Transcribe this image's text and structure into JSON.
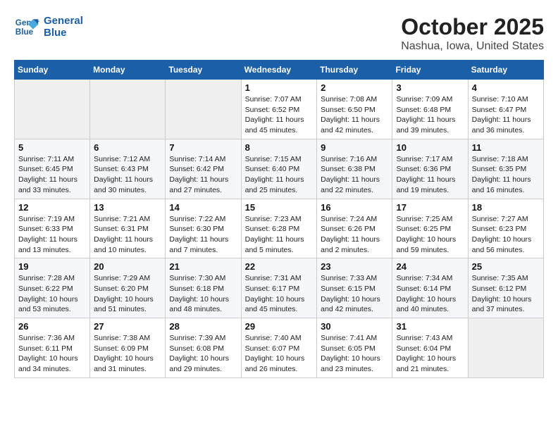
{
  "header": {
    "logo_line1": "General",
    "logo_line2": "Blue",
    "title": "October 2025",
    "subtitle": "Nashua, Iowa, United States"
  },
  "days_of_week": [
    "Sunday",
    "Monday",
    "Tuesday",
    "Wednesday",
    "Thursday",
    "Friday",
    "Saturday"
  ],
  "weeks": [
    [
      {
        "day": "",
        "info": ""
      },
      {
        "day": "",
        "info": ""
      },
      {
        "day": "",
        "info": ""
      },
      {
        "day": "1",
        "info": "Sunrise: 7:07 AM\nSunset: 6:52 PM\nDaylight: 11 hours and 45 minutes."
      },
      {
        "day": "2",
        "info": "Sunrise: 7:08 AM\nSunset: 6:50 PM\nDaylight: 11 hours and 42 minutes."
      },
      {
        "day": "3",
        "info": "Sunrise: 7:09 AM\nSunset: 6:48 PM\nDaylight: 11 hours and 39 minutes."
      },
      {
        "day": "4",
        "info": "Sunrise: 7:10 AM\nSunset: 6:47 PM\nDaylight: 11 hours and 36 minutes."
      }
    ],
    [
      {
        "day": "5",
        "info": "Sunrise: 7:11 AM\nSunset: 6:45 PM\nDaylight: 11 hours and 33 minutes."
      },
      {
        "day": "6",
        "info": "Sunrise: 7:12 AM\nSunset: 6:43 PM\nDaylight: 11 hours and 30 minutes."
      },
      {
        "day": "7",
        "info": "Sunrise: 7:14 AM\nSunset: 6:42 PM\nDaylight: 11 hours and 27 minutes."
      },
      {
        "day": "8",
        "info": "Sunrise: 7:15 AM\nSunset: 6:40 PM\nDaylight: 11 hours and 25 minutes."
      },
      {
        "day": "9",
        "info": "Sunrise: 7:16 AM\nSunset: 6:38 PM\nDaylight: 11 hours and 22 minutes."
      },
      {
        "day": "10",
        "info": "Sunrise: 7:17 AM\nSunset: 6:36 PM\nDaylight: 11 hours and 19 minutes."
      },
      {
        "day": "11",
        "info": "Sunrise: 7:18 AM\nSunset: 6:35 PM\nDaylight: 11 hours and 16 minutes."
      }
    ],
    [
      {
        "day": "12",
        "info": "Sunrise: 7:19 AM\nSunset: 6:33 PM\nDaylight: 11 hours and 13 minutes."
      },
      {
        "day": "13",
        "info": "Sunrise: 7:21 AM\nSunset: 6:31 PM\nDaylight: 11 hours and 10 minutes."
      },
      {
        "day": "14",
        "info": "Sunrise: 7:22 AM\nSunset: 6:30 PM\nDaylight: 11 hours and 7 minutes."
      },
      {
        "day": "15",
        "info": "Sunrise: 7:23 AM\nSunset: 6:28 PM\nDaylight: 11 hours and 5 minutes."
      },
      {
        "day": "16",
        "info": "Sunrise: 7:24 AM\nSunset: 6:26 PM\nDaylight: 11 hours and 2 minutes."
      },
      {
        "day": "17",
        "info": "Sunrise: 7:25 AM\nSunset: 6:25 PM\nDaylight: 10 hours and 59 minutes."
      },
      {
        "day": "18",
        "info": "Sunrise: 7:27 AM\nSunset: 6:23 PM\nDaylight: 10 hours and 56 minutes."
      }
    ],
    [
      {
        "day": "19",
        "info": "Sunrise: 7:28 AM\nSunset: 6:22 PM\nDaylight: 10 hours and 53 minutes."
      },
      {
        "day": "20",
        "info": "Sunrise: 7:29 AM\nSunset: 6:20 PM\nDaylight: 10 hours and 51 minutes."
      },
      {
        "day": "21",
        "info": "Sunrise: 7:30 AM\nSunset: 6:18 PM\nDaylight: 10 hours and 48 minutes."
      },
      {
        "day": "22",
        "info": "Sunrise: 7:31 AM\nSunset: 6:17 PM\nDaylight: 10 hours and 45 minutes."
      },
      {
        "day": "23",
        "info": "Sunrise: 7:33 AM\nSunset: 6:15 PM\nDaylight: 10 hours and 42 minutes."
      },
      {
        "day": "24",
        "info": "Sunrise: 7:34 AM\nSunset: 6:14 PM\nDaylight: 10 hours and 40 minutes."
      },
      {
        "day": "25",
        "info": "Sunrise: 7:35 AM\nSunset: 6:12 PM\nDaylight: 10 hours and 37 minutes."
      }
    ],
    [
      {
        "day": "26",
        "info": "Sunrise: 7:36 AM\nSunset: 6:11 PM\nDaylight: 10 hours and 34 minutes."
      },
      {
        "day": "27",
        "info": "Sunrise: 7:38 AM\nSunset: 6:09 PM\nDaylight: 10 hours and 31 minutes."
      },
      {
        "day": "28",
        "info": "Sunrise: 7:39 AM\nSunset: 6:08 PM\nDaylight: 10 hours and 29 minutes."
      },
      {
        "day": "29",
        "info": "Sunrise: 7:40 AM\nSunset: 6:07 PM\nDaylight: 10 hours and 26 minutes."
      },
      {
        "day": "30",
        "info": "Sunrise: 7:41 AM\nSunset: 6:05 PM\nDaylight: 10 hours and 23 minutes."
      },
      {
        "day": "31",
        "info": "Sunrise: 7:43 AM\nSunset: 6:04 PM\nDaylight: 10 hours and 21 minutes."
      },
      {
        "day": "",
        "info": ""
      }
    ]
  ]
}
